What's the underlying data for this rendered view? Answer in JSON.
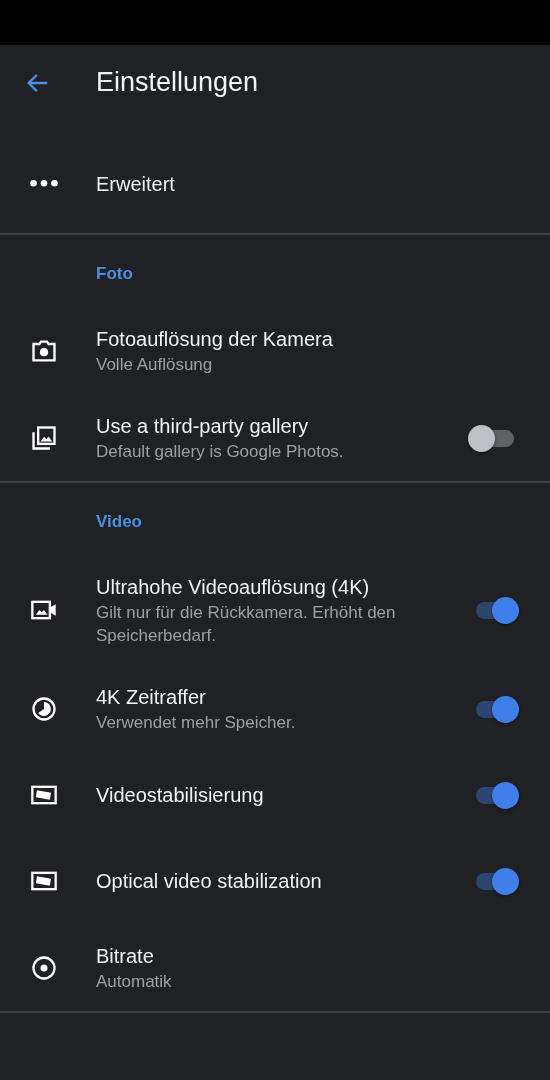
{
  "toolbar": {
    "title": "Einstellungen"
  },
  "top_item": {
    "title": "Erweitert"
  },
  "sections": [
    {
      "header": "Foto",
      "items": [
        {
          "kind": "plain",
          "title": "Fotoauflösung der Kamera",
          "subtitle": "Volle Auflösung"
        },
        {
          "kind": "switch",
          "title": "Use a third-party gallery",
          "subtitle": "Default gallery is Google Photos.",
          "on": false
        }
      ]
    },
    {
      "header": "Video",
      "items": [
        {
          "kind": "switch",
          "title": "Ultrahohe Videoauflösung (4K)",
          "subtitle": "Gilt nur für die Rückkamera. Erhöht den Speicherbedarf.",
          "on": true
        },
        {
          "kind": "switch",
          "title": "4K Zeitraffer",
          "subtitle": "Verwendet mehr Speicher.",
          "on": true
        },
        {
          "kind": "switch",
          "title": "Videostabilisierung",
          "on": true
        },
        {
          "kind": "switch",
          "title": "Optical video stabilization",
          "on": true
        },
        {
          "kind": "plain",
          "title": "Bitrate",
          "subtitle": "Automatik"
        }
      ]
    }
  ]
}
